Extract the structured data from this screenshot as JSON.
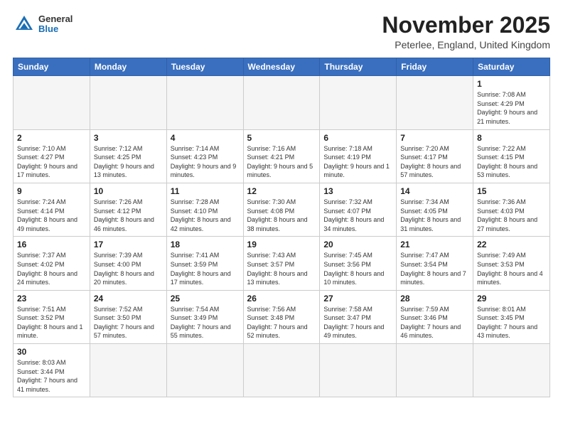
{
  "header": {
    "logo_general": "General",
    "logo_blue": "Blue",
    "title": "November 2025",
    "subtitle": "Peterlee, England, United Kingdom"
  },
  "days_of_week": [
    "Sunday",
    "Monday",
    "Tuesday",
    "Wednesday",
    "Thursday",
    "Friday",
    "Saturday"
  ],
  "weeks": [
    [
      {
        "day": "",
        "info": ""
      },
      {
        "day": "",
        "info": ""
      },
      {
        "day": "",
        "info": ""
      },
      {
        "day": "",
        "info": ""
      },
      {
        "day": "",
        "info": ""
      },
      {
        "day": "",
        "info": ""
      },
      {
        "day": "1",
        "info": "Sunrise: 7:08 AM\nSunset: 4:29 PM\nDaylight: 9 hours and 21 minutes."
      }
    ],
    [
      {
        "day": "2",
        "info": "Sunrise: 7:10 AM\nSunset: 4:27 PM\nDaylight: 9 hours and 17 minutes."
      },
      {
        "day": "3",
        "info": "Sunrise: 7:12 AM\nSunset: 4:25 PM\nDaylight: 9 hours and 13 minutes."
      },
      {
        "day": "4",
        "info": "Sunrise: 7:14 AM\nSunset: 4:23 PM\nDaylight: 9 hours and 9 minutes."
      },
      {
        "day": "5",
        "info": "Sunrise: 7:16 AM\nSunset: 4:21 PM\nDaylight: 9 hours and 5 minutes."
      },
      {
        "day": "6",
        "info": "Sunrise: 7:18 AM\nSunset: 4:19 PM\nDaylight: 9 hours and 1 minute."
      },
      {
        "day": "7",
        "info": "Sunrise: 7:20 AM\nSunset: 4:17 PM\nDaylight: 8 hours and 57 minutes."
      },
      {
        "day": "8",
        "info": "Sunrise: 7:22 AM\nSunset: 4:15 PM\nDaylight: 8 hours and 53 minutes."
      }
    ],
    [
      {
        "day": "9",
        "info": "Sunrise: 7:24 AM\nSunset: 4:14 PM\nDaylight: 8 hours and 49 minutes."
      },
      {
        "day": "10",
        "info": "Sunrise: 7:26 AM\nSunset: 4:12 PM\nDaylight: 8 hours and 46 minutes."
      },
      {
        "day": "11",
        "info": "Sunrise: 7:28 AM\nSunset: 4:10 PM\nDaylight: 8 hours and 42 minutes."
      },
      {
        "day": "12",
        "info": "Sunrise: 7:30 AM\nSunset: 4:08 PM\nDaylight: 8 hours and 38 minutes."
      },
      {
        "day": "13",
        "info": "Sunrise: 7:32 AM\nSunset: 4:07 PM\nDaylight: 8 hours and 34 minutes."
      },
      {
        "day": "14",
        "info": "Sunrise: 7:34 AM\nSunset: 4:05 PM\nDaylight: 8 hours and 31 minutes."
      },
      {
        "day": "15",
        "info": "Sunrise: 7:36 AM\nSunset: 4:03 PM\nDaylight: 8 hours and 27 minutes."
      }
    ],
    [
      {
        "day": "16",
        "info": "Sunrise: 7:37 AM\nSunset: 4:02 PM\nDaylight: 8 hours and 24 minutes."
      },
      {
        "day": "17",
        "info": "Sunrise: 7:39 AM\nSunset: 4:00 PM\nDaylight: 8 hours and 20 minutes."
      },
      {
        "day": "18",
        "info": "Sunrise: 7:41 AM\nSunset: 3:59 PM\nDaylight: 8 hours and 17 minutes."
      },
      {
        "day": "19",
        "info": "Sunrise: 7:43 AM\nSunset: 3:57 PM\nDaylight: 8 hours and 13 minutes."
      },
      {
        "day": "20",
        "info": "Sunrise: 7:45 AM\nSunset: 3:56 PM\nDaylight: 8 hours and 10 minutes."
      },
      {
        "day": "21",
        "info": "Sunrise: 7:47 AM\nSunset: 3:54 PM\nDaylight: 8 hours and 7 minutes."
      },
      {
        "day": "22",
        "info": "Sunrise: 7:49 AM\nSunset: 3:53 PM\nDaylight: 8 hours and 4 minutes."
      }
    ],
    [
      {
        "day": "23",
        "info": "Sunrise: 7:51 AM\nSunset: 3:52 PM\nDaylight: 8 hours and 1 minute."
      },
      {
        "day": "24",
        "info": "Sunrise: 7:52 AM\nSunset: 3:50 PM\nDaylight: 7 hours and 57 minutes."
      },
      {
        "day": "25",
        "info": "Sunrise: 7:54 AM\nSunset: 3:49 PM\nDaylight: 7 hours and 55 minutes."
      },
      {
        "day": "26",
        "info": "Sunrise: 7:56 AM\nSunset: 3:48 PM\nDaylight: 7 hours and 52 minutes."
      },
      {
        "day": "27",
        "info": "Sunrise: 7:58 AM\nSunset: 3:47 PM\nDaylight: 7 hours and 49 minutes."
      },
      {
        "day": "28",
        "info": "Sunrise: 7:59 AM\nSunset: 3:46 PM\nDaylight: 7 hours and 46 minutes."
      },
      {
        "day": "29",
        "info": "Sunrise: 8:01 AM\nSunset: 3:45 PM\nDaylight: 7 hours and 43 minutes."
      }
    ],
    [
      {
        "day": "30",
        "info": "Sunrise: 8:03 AM\nSunset: 3:44 PM\nDaylight: 7 hours and 41 minutes."
      },
      {
        "day": "",
        "info": ""
      },
      {
        "day": "",
        "info": ""
      },
      {
        "day": "",
        "info": ""
      },
      {
        "day": "",
        "info": ""
      },
      {
        "day": "",
        "info": ""
      },
      {
        "day": "",
        "info": ""
      }
    ]
  ]
}
